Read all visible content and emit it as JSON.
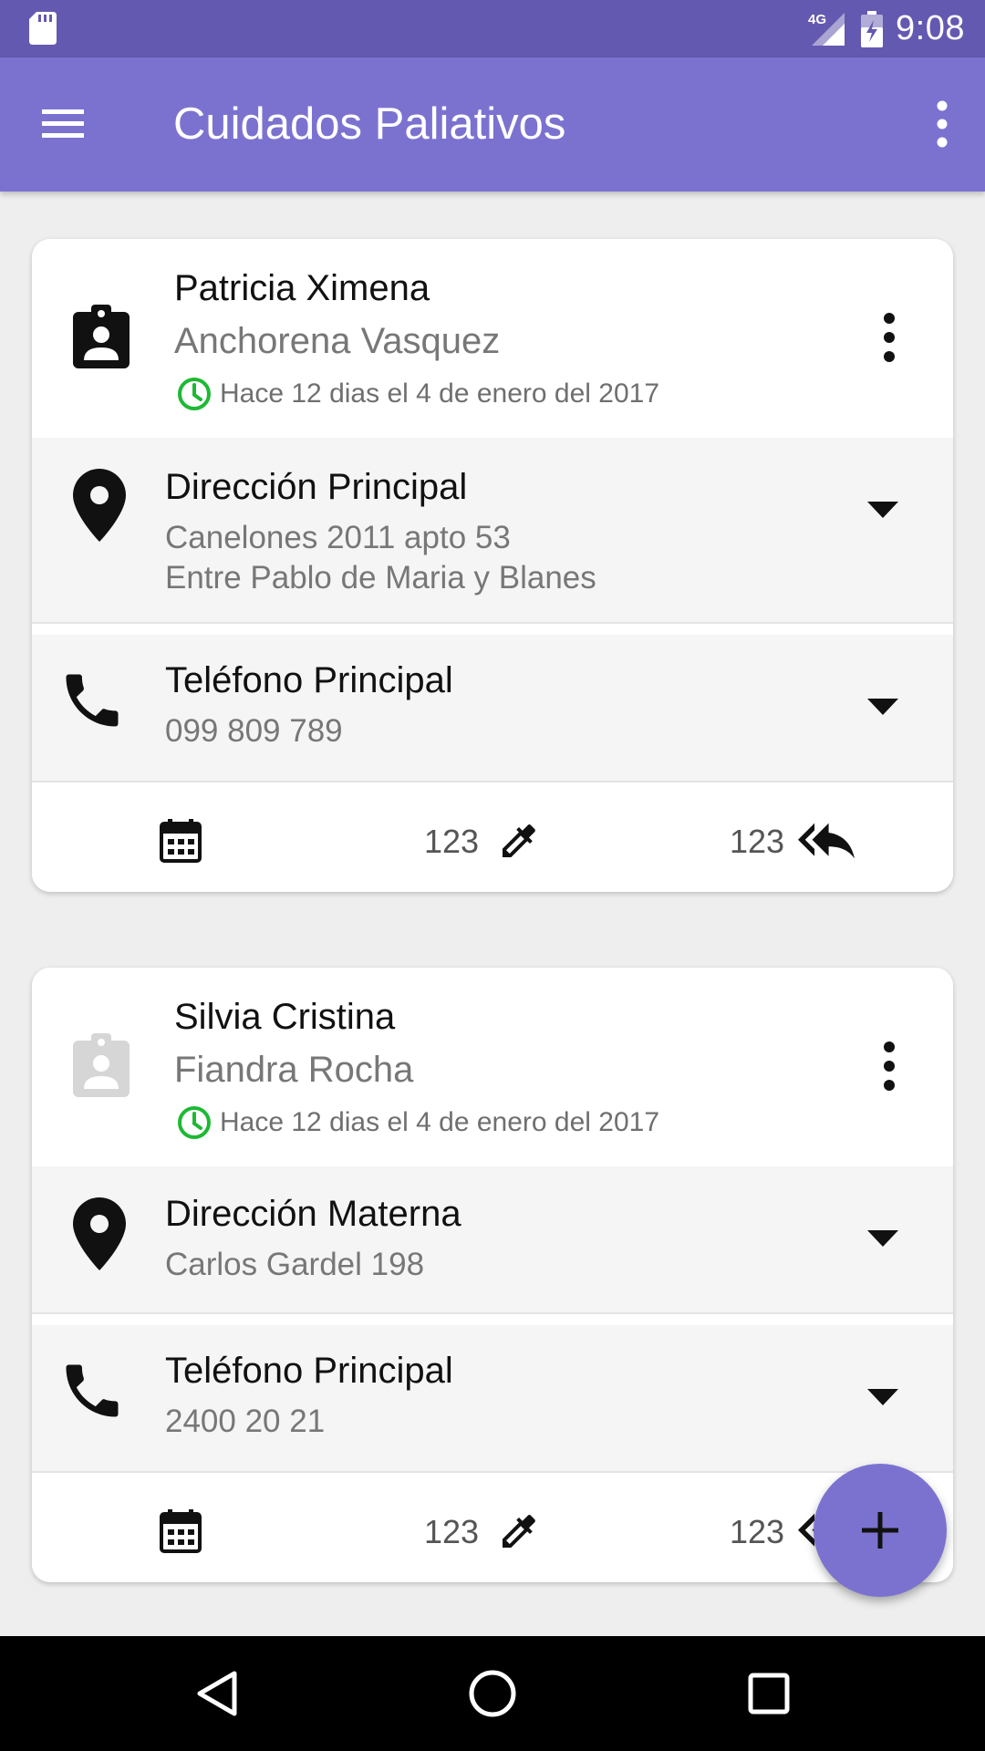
{
  "status_bar": {
    "network": "4G",
    "time": "9:08"
  },
  "app_bar": {
    "title": "Cuidados Paliativos",
    "menu_icon": "hamburger-menu-icon",
    "overflow_icon": "more-vert-icon"
  },
  "colors": {
    "primary": "#7b72d0",
    "primary_dark": "#6459b0",
    "clock_green": "#1db934",
    "inactive_badge": "#d6d6d6"
  },
  "patients": [
    {
      "first_name": "Patricia Ximena",
      "last_name": "Anchorena Vasquez",
      "time_label": "Hace 12 dias el 4 de enero del 2017",
      "badge_active": true,
      "address": {
        "label": "Dirección Principal",
        "lines": [
          "Canelones 2011 apto 53",
          "Entre Pablo de Maria y Blanes"
        ]
      },
      "phone": {
        "label": "Teléfono Principal",
        "number": "099 809 789"
      },
      "footer": {
        "count_a": "123",
        "count_b": "123"
      }
    },
    {
      "first_name": "Silvia Cristina",
      "last_name": "Fiandra Rocha",
      "time_label": "Hace 12 dias el 4 de enero del 2017",
      "badge_active": false,
      "address": {
        "label": "Dirección Materna",
        "lines": [
          "Carlos Gardel 198"
        ]
      },
      "phone": {
        "label": "Teléfono Principal",
        "number": "2400 20 21"
      },
      "footer": {
        "count_a": "123",
        "count_b": "123"
      }
    }
  ],
  "fab": {
    "icon": "add-icon"
  },
  "nav_bar": {
    "icons": [
      "back-icon",
      "home-icon",
      "recents-icon"
    ]
  }
}
